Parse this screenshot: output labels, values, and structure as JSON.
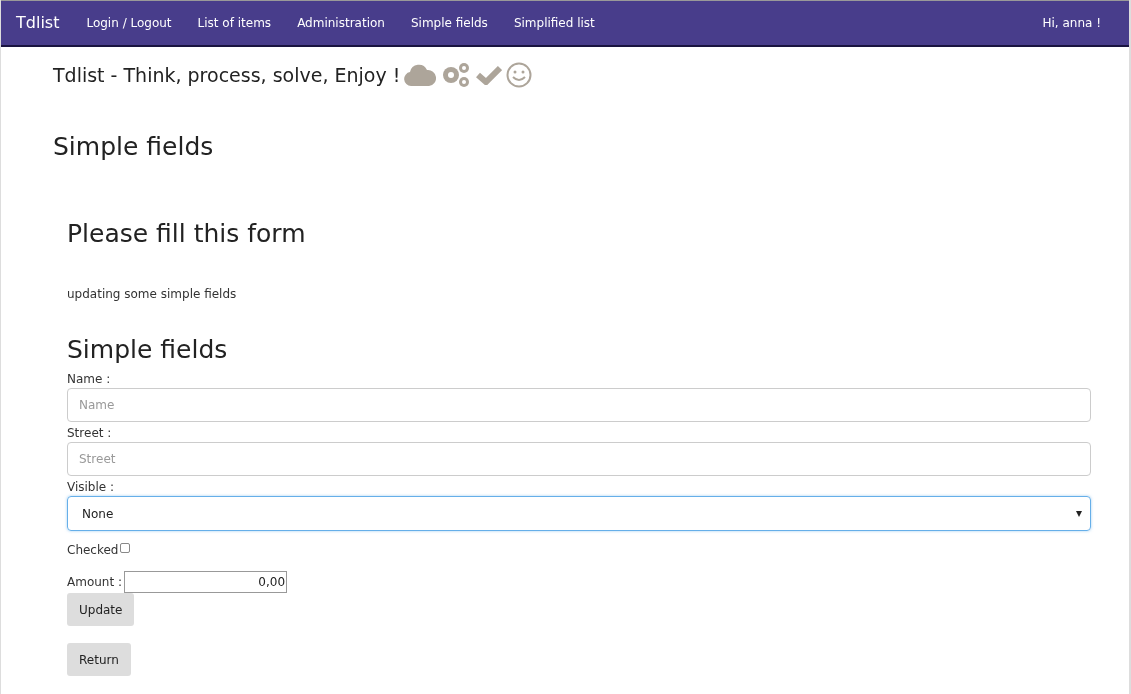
{
  "navbar": {
    "brand": "Tdlist",
    "links": [
      "Login / Logout",
      "List of items",
      "Administration",
      "Simple fields",
      "Simplified list"
    ],
    "user": "Hi, anna !"
  },
  "tagline": "Tdlist - Think, process, solve, Enjoy !",
  "page_title": "Simple fields",
  "form": {
    "heading": "Please fill this form",
    "description": "updating some simple fields",
    "section_title": "Simple fields",
    "fields": [
      {
        "kind": "text",
        "label": "Name :",
        "placeholder": "Name"
      },
      {
        "kind": "text",
        "label": "Street :",
        "placeholder": "Street"
      },
      {
        "kind": "select",
        "label": "Visible :",
        "value": "None",
        "focused": true
      }
    ],
    "checkbox": {
      "label": "Checked",
      "checked": false
    },
    "amount": {
      "label": "Amount :",
      "value": "0,00"
    },
    "buttons": [
      "Update",
      "Return"
    ]
  }
}
